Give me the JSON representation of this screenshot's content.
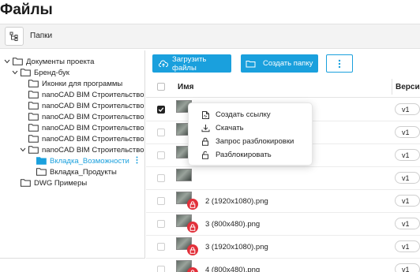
{
  "page": {
    "title": "Файлы"
  },
  "toolbar": {
    "folders_label": "Папки"
  },
  "tree": {
    "items": [
      {
        "label": "Документы проекта",
        "chevron": "down",
        "depth": 0
      },
      {
        "label": "Бренд-бук",
        "chevron": "down",
        "depth": 1
      },
      {
        "label": "Иконки для программы",
        "chevron": "",
        "depth": 2
      },
      {
        "label": "nanoCAD BIM Строительство.",
        "chevron": "",
        "depth": 2
      },
      {
        "label": "nanoCAD BIM Строительство.",
        "chevron": "",
        "depth": 2
      },
      {
        "label": "nanoCAD BIM Строительство.",
        "chevron": "",
        "depth": 2
      },
      {
        "label": "nanoCAD BIM Строительство.",
        "chevron": "",
        "depth": 2
      },
      {
        "label": "nanoCAD BIM Строительство.",
        "chevron": "",
        "depth": 2
      },
      {
        "label": "nanoCAD BIM Строительство.",
        "chevron": "down",
        "depth": 2
      },
      {
        "label": "Вкладка_Возможности",
        "chevron": "",
        "depth": 3,
        "active": true
      },
      {
        "label": "Вкладка_Продукты",
        "chevron": "",
        "depth": 3
      },
      {
        "label": "DWG Примеры",
        "chevron": "",
        "depth": 1
      }
    ]
  },
  "actions": {
    "upload_label": "Загрузить файлы",
    "create_folder_label": "Создать папку",
    "more_icon": "kebab-icon"
  },
  "table": {
    "col_name": "Имя",
    "col_version": "Версия",
    "rows": [
      {
        "name": "",
        "version": "v1",
        "checked": true,
        "locked": false
      },
      {
        "name": "",
        "version": "v1",
        "checked": false,
        "locked": false
      },
      {
        "name": "",
        "version": "v1",
        "checked": false,
        "locked": false
      },
      {
        "name": "",
        "version": "v1",
        "checked": false,
        "locked": false
      },
      {
        "name": "2 (1920x1080).png",
        "version": "v1",
        "checked": false,
        "locked": true
      },
      {
        "name": "3 (800x480).png",
        "version": "v1",
        "checked": false,
        "locked": true
      },
      {
        "name": "3 (1920x1080).png",
        "version": "v1",
        "checked": false,
        "locked": true
      },
      {
        "name": "4 (800x480).png",
        "version": "v1",
        "checked": false,
        "locked": true
      }
    ]
  },
  "context_menu": {
    "items": [
      {
        "label": "Создать ссылку",
        "icon": "link-icon"
      },
      {
        "label": "Скачать",
        "icon": "download-icon"
      },
      {
        "label": "Запрос разблокировки",
        "icon": "lock-icon"
      },
      {
        "label": "Разблокировать",
        "icon": "unlock-icon"
      }
    ]
  },
  "colors": {
    "accent": "#1aa0dd",
    "lock": "#e2303a"
  }
}
